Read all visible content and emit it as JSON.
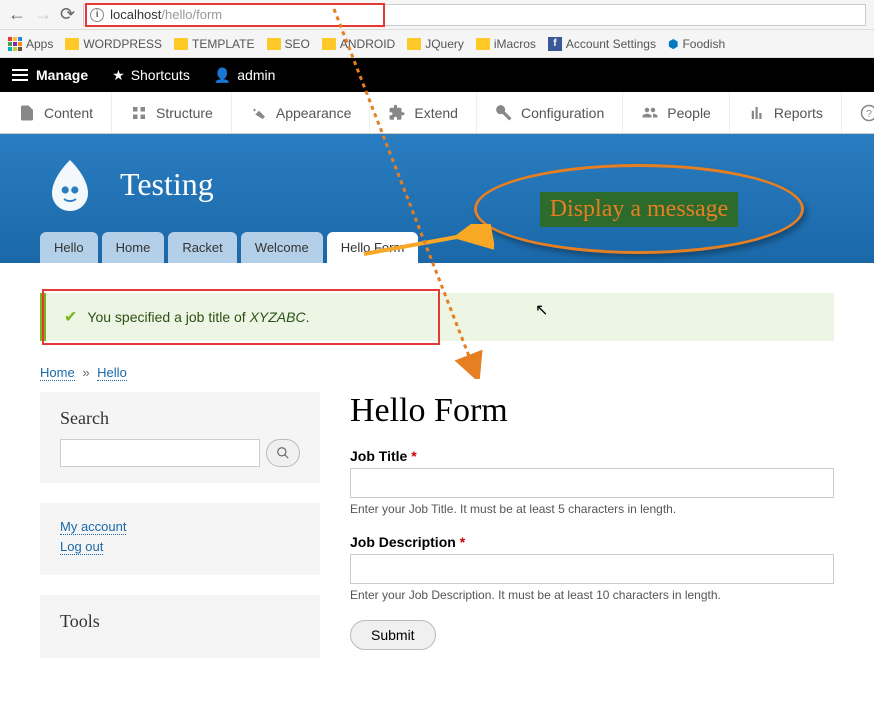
{
  "browser": {
    "url_host": "localhost",
    "url_path": "/hello/form"
  },
  "bookmarks": {
    "apps": "Apps",
    "items": [
      "WORDPRESS",
      "TEMPLATE",
      "SEO",
      "ANDROID",
      "JQuery",
      "iMacros"
    ],
    "account": "Account Settings",
    "foodish": "Foodish"
  },
  "blackbar": {
    "manage": "Manage",
    "shortcuts": "Shortcuts",
    "admin": "admin"
  },
  "adminmenu": {
    "content": "Content",
    "structure": "Structure",
    "appearance": "Appearance",
    "extend": "Extend",
    "configuration": "Configuration",
    "people": "People",
    "reports": "Reports",
    "help": "Help"
  },
  "site": {
    "name": "Testing"
  },
  "tabs": [
    "Hello",
    "Home",
    "Racket",
    "Welcome",
    "Hello Form"
  ],
  "annotation": {
    "label": "Display a message"
  },
  "status": {
    "prefix": "You specified a job title of ",
    "value": "XYZABC",
    "suffix": "."
  },
  "breadcrumb": {
    "home": "Home",
    "hello": "Hello"
  },
  "sidebar": {
    "search": {
      "title": "Search",
      "placeholder": ""
    },
    "user": {
      "myaccount": "My account",
      "logout": "Log out"
    },
    "tools": {
      "title": "Tools"
    }
  },
  "form": {
    "title": "Hello Form",
    "jobtitle": {
      "label": "Job Title",
      "desc": "Enter your Job Title. It must be at least 5 characters in length."
    },
    "jobdesc": {
      "label": "Job Description",
      "desc": "Enter your Job Description. It must be at least 10 characters in length."
    },
    "submit": "Submit"
  }
}
